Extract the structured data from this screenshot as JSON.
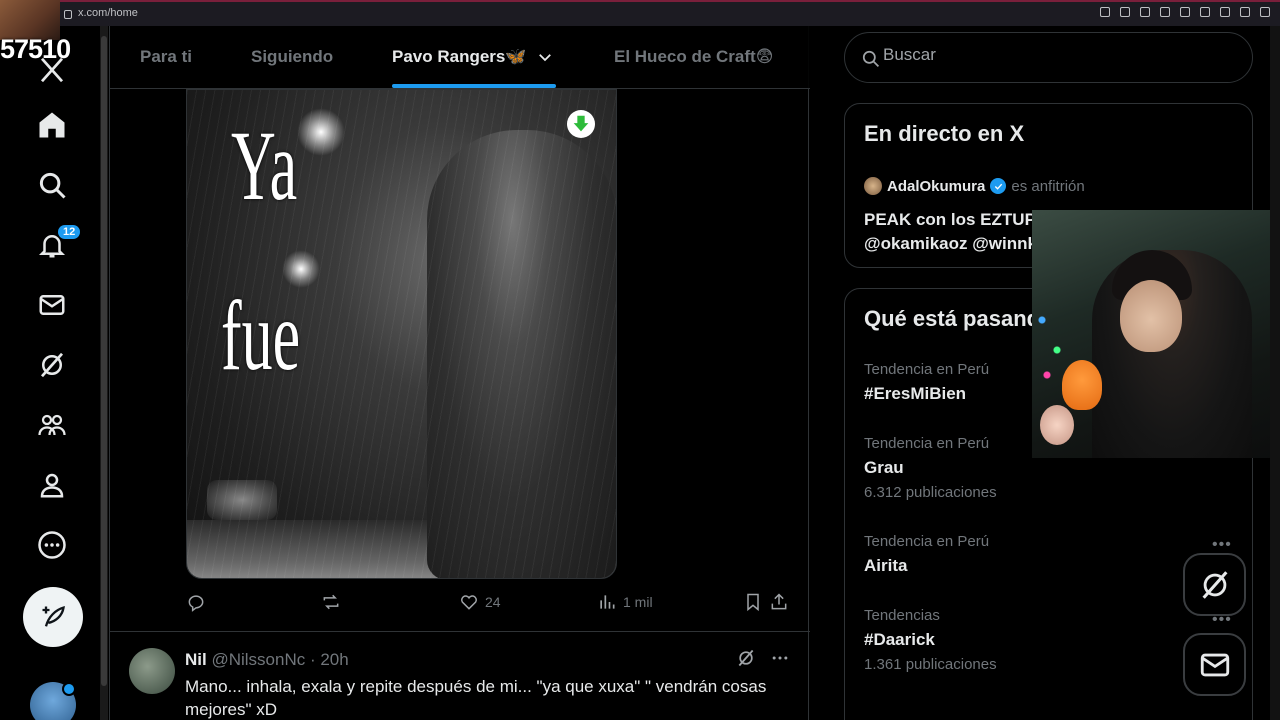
{
  "browser": {
    "url": "x.com/home"
  },
  "stream_overlay": {
    "counter": "57510"
  },
  "nav": {
    "notifications_badge": "12",
    "items": [
      "x-logo",
      "home-icon",
      "search-icon",
      "bell-icon",
      "mail-icon",
      "grok-icon",
      "communities-icon",
      "profile-icon",
      "more-icon"
    ]
  },
  "tabs": [
    "Para ti",
    "Siguiendo",
    "Pavo Rangers🦋",
    "El Hueco de Craft😨"
  ],
  "active_tab": 2,
  "post": {
    "meme_line1": "Ya",
    "meme_line2": "fue",
    "likes": "24",
    "views": "1 mil"
  },
  "reply": {
    "name": "Nil",
    "handle": "@NilssonNc · 20h",
    "text": "Mano... inhala, exala y repite después de mi... \"ya que xuxa\" \" vendrán cosas mejores\" xD"
  },
  "search": {
    "placeholder": "Buscar"
  },
  "live": {
    "title": "En directo en X",
    "host_name": "AdalOkumura",
    "host_role": "es anfitrión",
    "space_title": "PEAK con los EZTUPIDOS",
    "space_subtitle": "@okamikaoz @winnk"
  },
  "trends": {
    "title": "Qué está pasando",
    "items": [
      {
        "context": "Tendencia en Perú",
        "name": "#EresMiBien",
        "count": ""
      },
      {
        "context": "Tendencia en Perú",
        "name": "Grau",
        "count": "6.312 publicaciones"
      },
      {
        "context": "Tendencia en Perú",
        "name": "Airita",
        "count": ""
      },
      {
        "context": "Tendencias",
        "name": "#Daarick",
        "count": "1.361 publicaciones"
      }
    ]
  },
  "colors": {
    "accent": "#1d9bf0",
    "muted": "#71767b",
    "text": "#e7e9ea",
    "border": "#2f3336"
  }
}
